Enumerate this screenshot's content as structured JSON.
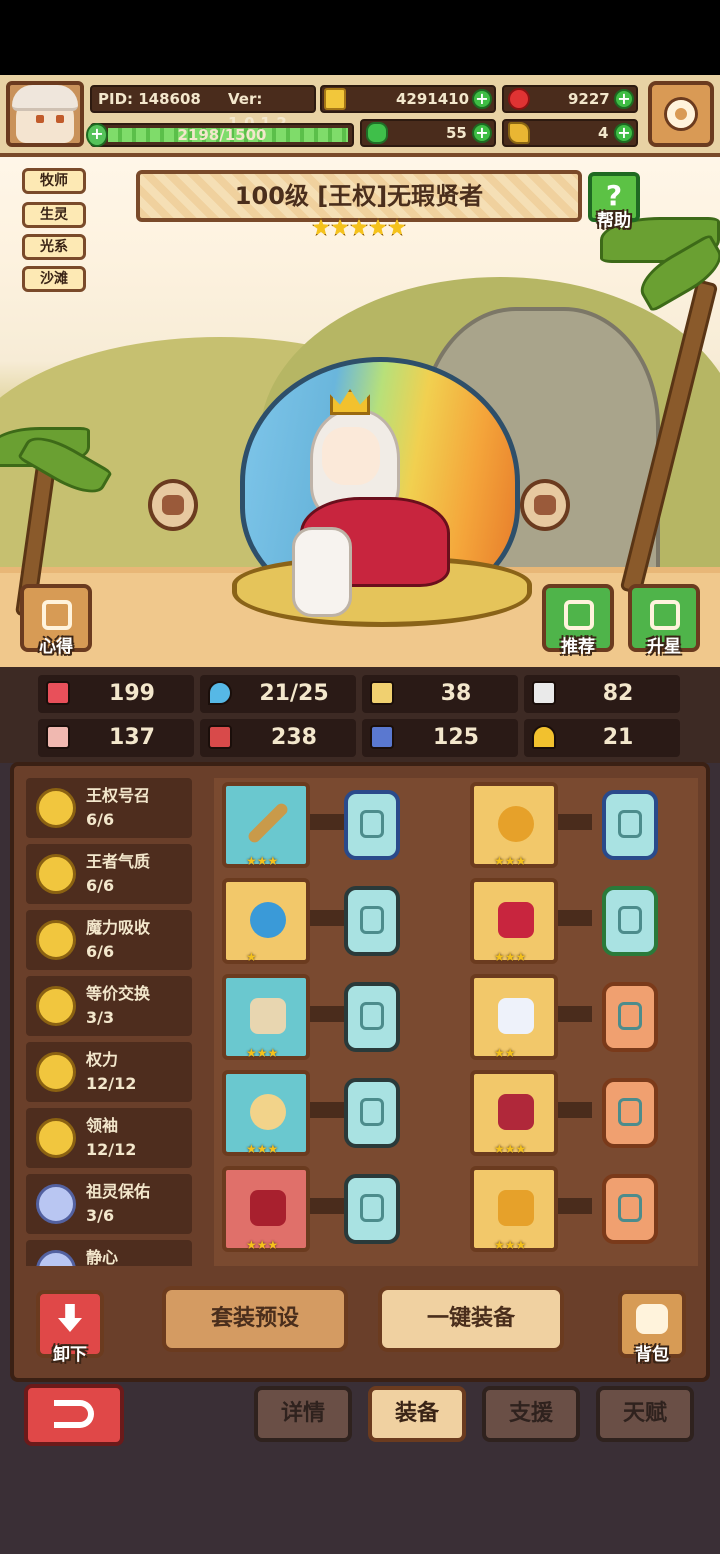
{
  "player": {
    "pid": "PID: 148608",
    "version": "Ver: 1.0.1.2",
    "gold": "4291410",
    "rubies": "9227",
    "exp": "2198/1500",
    "clovers": "55",
    "keys": "4"
  },
  "tags": [
    "牧师",
    "生灵",
    "光系",
    "沙滩"
  ],
  "hero": {
    "title": "100级  [王权]无瑕贤者",
    "stars": 5
  },
  "buttons": {
    "help": "帮助",
    "notes": "心得",
    "recommend": "推荐",
    "star_up": "升星",
    "unequip": "卸下",
    "preset": "套装预设",
    "auto_equip": "一键装备",
    "bag": "背包"
  },
  "stats": [
    {
      "icon": "heart-icon",
      "value": "199",
      "color": "#e8505a"
    },
    {
      "icon": "water-drop-icon",
      "value": "21/25",
      "color": "#56b8e6"
    },
    {
      "icon": "shield-icon",
      "value": "38",
      "color": "#f0d070"
    },
    {
      "icon": "feather-icon",
      "value": "82",
      "color": "#eaeaea"
    },
    {
      "icon": "fist-icon",
      "value": "137",
      "color": "#f0b8b0"
    },
    {
      "icon": "book-icon",
      "value": "238",
      "color": "#d84a4a"
    },
    {
      "icon": "boot-icon",
      "value": "125",
      "color": "#5a78d0"
    },
    {
      "icon": "horseshoe-icon",
      "value": "21",
      "color": "#f2c12e"
    }
  ],
  "sets": [
    {
      "name": "王权号召",
      "count": "6/6"
    },
    {
      "name": "王者气质",
      "count": "6/6"
    },
    {
      "name": "魔力吸收",
      "count": "6/6"
    },
    {
      "name": "等价交换",
      "count": "3/3"
    },
    {
      "name": "权力",
      "count": "12/12"
    },
    {
      "name": "领袖",
      "count": "12/12"
    },
    {
      "name": "祖灵保佑",
      "count": "3/6"
    },
    {
      "name": "静心",
      "count": ""
    }
  ],
  "tabs": [
    "详情",
    "装备",
    "支援",
    "天赋"
  ],
  "active_tab": "装备"
}
